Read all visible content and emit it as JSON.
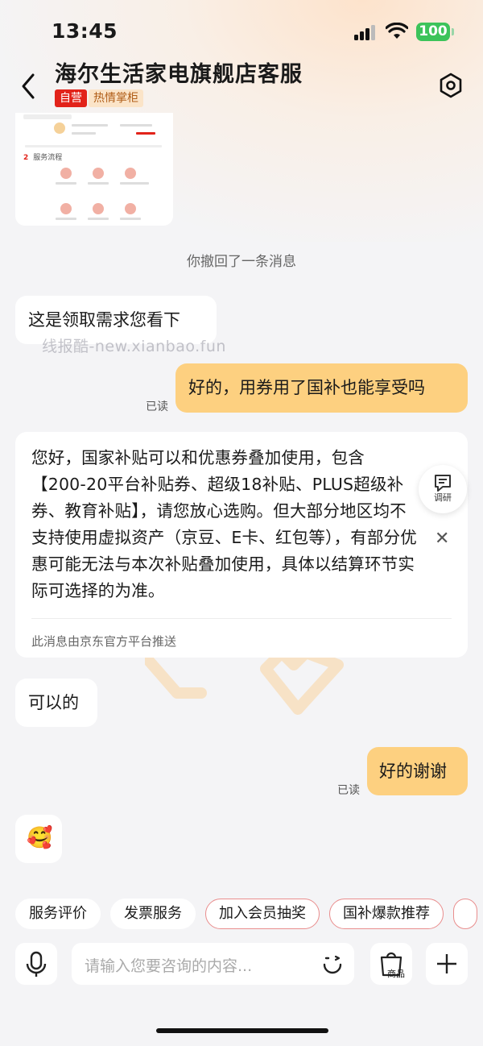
{
  "status_bar": {
    "time": "13:45",
    "battery": "100"
  },
  "header": {
    "title": "海尔生活家电旗舰店客服",
    "tag_self": "自营",
    "tag_host": "热情掌柜"
  },
  "image_card": {
    "section_num": "2",
    "section_label": "服务流程"
  },
  "system_note": "你撤回了一条消息",
  "messages": {
    "m1": "这是领取需求您看下",
    "m2": "好的，用券用了国补也能享受吗",
    "m2_read": "已读",
    "m3_line1": "您好，国家补贴可以和优惠券叠加使用，包含",
    "m3_line2": "【200-20平台补贴券、超级18补贴、PLUS超级补",
    "m3_line3": "券、教育补贴】，请您放心选购。但大部分地区均不",
    "m3_line4": "支持使用虚拟资产（京豆、E卡、红包等），有部分优",
    "m3_line5": "惠可能无法与本次补贴叠加使用，具体以结算环节实",
    "m3_line6": "际可选择的为准。",
    "m3_footer": "此消息由京东官方平台推送",
    "m4": "可以的",
    "m5": "好的谢谢",
    "m5_read": "已读",
    "m6_emoji": "🥰"
  },
  "watermark": "线报酷-new.xianbao.fun",
  "float_research": {
    "label": "调研"
  },
  "quick_chips": [
    "服务评价",
    "发票服务",
    "加入会员抽奖",
    "国补爆款推荐"
  ],
  "input": {
    "placeholder": "请输入您要咨询的内容...",
    "goods_label": "商品"
  },
  "colors": {
    "accent_red": "#e2231a",
    "bubble_out": "#fdd080",
    "battery": "#3cc35a"
  }
}
